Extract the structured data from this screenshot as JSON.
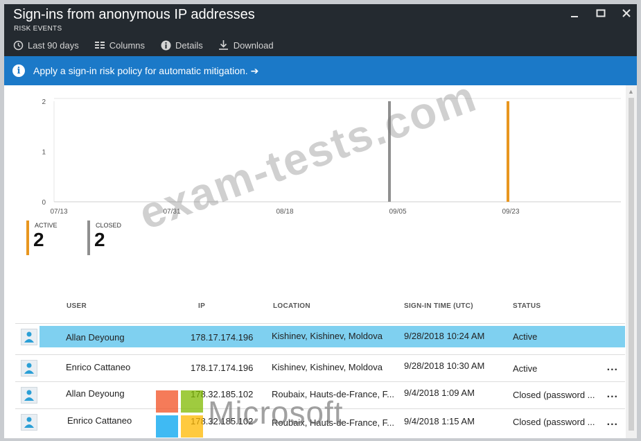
{
  "window": {
    "title": "Sign-ins from anonymous IP addresses",
    "subtitle": "RISK EVENTS"
  },
  "toolbar": {
    "items": [
      {
        "label": "Last 90 days",
        "icon": "clock-icon"
      },
      {
        "label": "Columns",
        "icon": "columns-icon"
      },
      {
        "label": "Details",
        "icon": "info-icon"
      },
      {
        "label": "Download",
        "icon": "download-icon"
      }
    ]
  },
  "banner": {
    "text": "Apply a sign-in risk policy for automatic mitigation. ➔"
  },
  "chart_data": {
    "type": "bar",
    "x_ticks": [
      "07/13",
      "07/31",
      "08/18",
      "09/05",
      "09/23"
    ],
    "y_ticks": [
      "2",
      "1",
      "0"
    ],
    "ylim": [
      0,
      2
    ],
    "series": [
      {
        "name": "ACTIVE",
        "color": "#e8961f",
        "points": [
          {
            "x": "09/23",
            "value": 2
          }
        ]
      },
      {
        "name": "CLOSED",
        "color": "#8f8f8f",
        "points": [
          {
            "x": "09/05",
            "value": 2
          }
        ]
      }
    ]
  },
  "summary": {
    "active": {
      "label": "ACTIVE",
      "value": "2",
      "color": "#e8961f"
    },
    "closed": {
      "label": "CLOSED",
      "value": "2",
      "color": "#8f8f8f"
    }
  },
  "table": {
    "columns": [
      "USER",
      "IP",
      "LOCATION",
      "SIGN-IN TIME (UTC)",
      "STATUS"
    ],
    "rows": [
      {
        "user": "Allan Deyoung",
        "ip": "178.17.174.196",
        "location": "Kishinev, Kishinev, Moldova",
        "time": "9/28/2018 10:24 AM",
        "status": "Active",
        "selected": true,
        "more": ""
      },
      {
        "user": "Enrico Cattaneo",
        "ip": "178.17.174.196",
        "location": "Kishinev, Kishinev, Moldova",
        "time": "9/28/2018 10:30 AM",
        "status": "Active",
        "selected": false,
        "more": "..."
      },
      {
        "user": "Allan Deyoung",
        "ip": "178.32.185.102",
        "location": "Roubaix, Hauts-de-France, F...",
        "time": "9/4/2018 1:09 AM",
        "status": "Closed (password ...",
        "selected": false,
        "more": "..."
      },
      {
        "user": "Enrico Cattaneo",
        "ip": "178.32.185.102",
        "location": "Roubaix, Hauts-de-France, F...",
        "time": "9/4/2018 1:15 AM",
        "status": "Closed (password ...",
        "selected": false,
        "more": "..."
      }
    ]
  },
  "watermarks": {
    "text": "exam-tests.com",
    "logo_text": "Microsoft"
  }
}
